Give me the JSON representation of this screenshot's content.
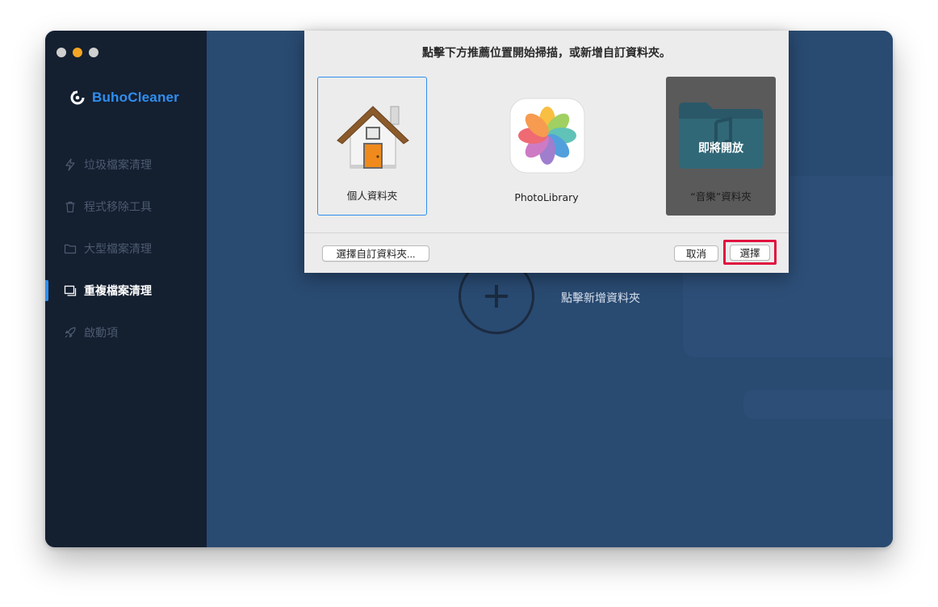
{
  "app": {
    "brand_name": "BuhoCleaner",
    "accent_color": "#2f8ff0"
  },
  "sidebar": {
    "items": [
      {
        "label": "垃圾檔案清理",
        "icon": "lightning-icon"
      },
      {
        "label": "程式移除工具",
        "icon": "trash-icon"
      },
      {
        "label": "大型檔案清理",
        "icon": "folder-icon"
      },
      {
        "label": "重複檔案清理",
        "icon": "duplicate-icon",
        "active": true
      },
      {
        "label": "啟動項",
        "icon": "rocket-icon"
      }
    ]
  },
  "main": {
    "add_folder_label": "點擊新增資料夾"
  },
  "dialog": {
    "title": "點擊下方推薦位置開始掃描，或新增自訂資料夾。",
    "cards": [
      {
        "label": "個人資料夾",
        "icon": "home-folder-icon",
        "selected": true
      },
      {
        "label": "PhotoLibrary",
        "icon": "photos-app-icon"
      },
      {
        "label": "“音樂”資料夾",
        "icon": "music-folder-icon",
        "overlay": "即將開放",
        "disabled": true
      }
    ],
    "custom_button": "選擇自訂資料夾...",
    "cancel_button": "取消",
    "select_button": "選擇",
    "highlight_color": "#e0123f"
  }
}
